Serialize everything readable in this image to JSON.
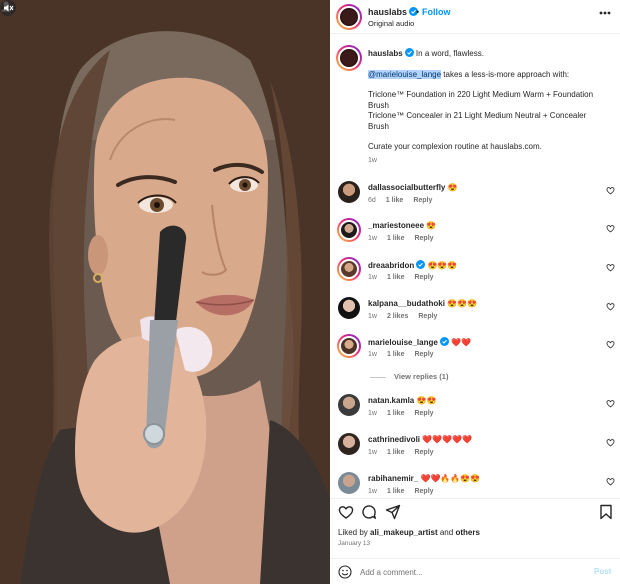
{
  "header": {
    "username": "hauslabs",
    "dot": "•",
    "follow_label": "Follow",
    "subtitle": "Original audio"
  },
  "caption": {
    "username": "hauslabs",
    "text1": "In a word, flawless.",
    "mention": "@marielouise_lange",
    "text2": "takes a less-is-more approach with:",
    "line3": "Triclone™ Foundation in 220 Light Medium Warm + Foundation Brush",
    "line4": "Triclone™ Concealer in 21 Light Medium Neutral + Concealer Brush",
    "line5": "Curate your complexion routine at hauslabs.com.",
    "time": "1w"
  },
  "comments": [
    {
      "username": "dallassocialbutterfly",
      "text": "😍",
      "time": "6d",
      "likes": "1 like",
      "reply": "Reply",
      "verified": false,
      "ring": false
    },
    {
      "username": "_mariestoneee",
      "text": "😍",
      "time": "1w",
      "likes": "1 like",
      "reply": "Reply",
      "verified": false,
      "ring": true
    },
    {
      "username": "dreaabridon",
      "text": "😍😍😍",
      "time": "1w",
      "likes": "1 like",
      "reply": "Reply",
      "verified": true,
      "ring": true
    },
    {
      "username": "kalpana__budathoki",
      "text": "😍😍😍",
      "time": "1w",
      "likes": "2 likes",
      "reply": "Reply",
      "verified": false,
      "ring": false
    },
    {
      "username": "marielouise_lange",
      "text": "❤️❤️",
      "time": "1w",
      "likes": "1 like",
      "reply": "Reply",
      "verified": true,
      "ring": true
    },
    {
      "username": "natan.kamla",
      "text": "😍😍",
      "time": "1w",
      "likes": "1 like",
      "reply": "Reply",
      "verified": false,
      "ring": false
    },
    {
      "username": "cathrinedivoli",
      "text": "❤️❤️❤️❤️❤️",
      "time": "1w",
      "likes": "1 like",
      "reply": "Reply",
      "verified": false,
      "ring": false
    },
    {
      "username": "rabihanemir_",
      "text": "❤️❤️🔥🔥😍😍",
      "time": "1w",
      "likes": "1 like",
      "reply": "Reply",
      "verified": false,
      "ring": false
    }
  ],
  "view_replies": "View replies (1)",
  "likes": {
    "prefix": "Liked by",
    "user": "ali_makeup_artist",
    "and": "and",
    "others": "others"
  },
  "date": "January 13",
  "comment_box": {
    "placeholder": "Add a comment...",
    "post_label": "Post"
  },
  "icons": {
    "verified": "verified-badge-icon",
    "more": "more-options-icon",
    "heart": "heart-icon",
    "comment": "comment-icon",
    "share": "share-icon",
    "save": "bookmark-icon",
    "emoji": "emoji-icon",
    "mute": "muted-audio-icon",
    "user": "tagged-user-icon"
  },
  "colors": {
    "accent": "#0095f6",
    "verified": "#0095f6",
    "post_disabled": "#b2dffc"
  }
}
